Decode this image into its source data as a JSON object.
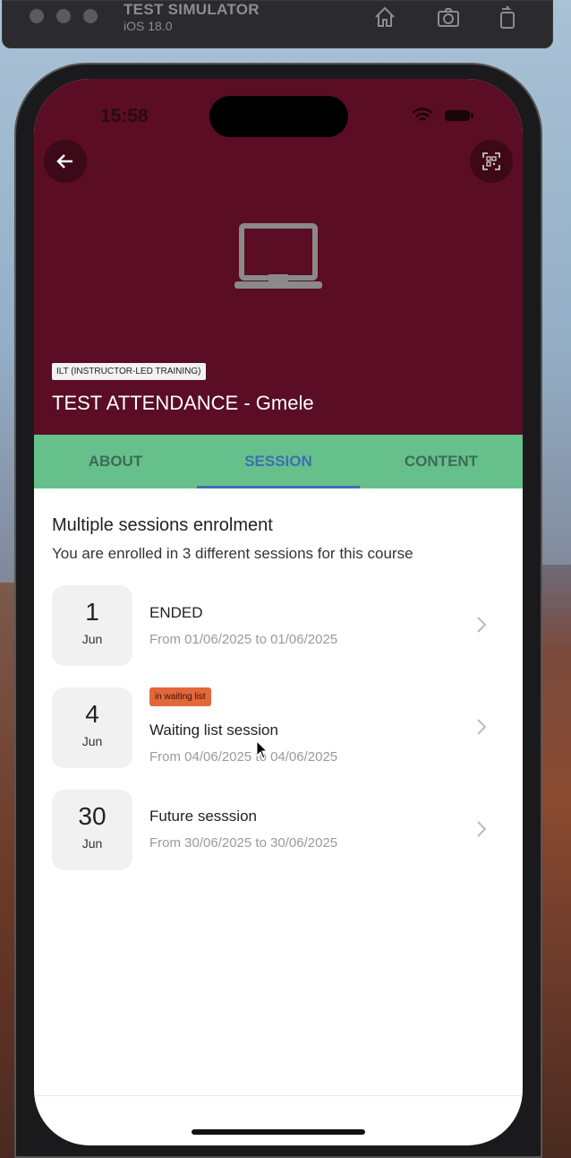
{
  "simulator": {
    "title": "TEST SIMULATOR",
    "subtitle": "iOS 18.0"
  },
  "status_bar": {
    "time": "15:58"
  },
  "hero": {
    "type_badge": "ILT (INSTRUCTOR-LED TRAINING)",
    "course_title": "TEST ATTENDANCE - Gmele"
  },
  "tabs": [
    {
      "label": "ABOUT",
      "active": false
    },
    {
      "label": "SESSION",
      "active": true
    },
    {
      "label": "CONTENT",
      "active": false
    }
  ],
  "enrolment": {
    "title": "Multiple sessions enrolment",
    "subtitle": "You are enrolled in 3 different sessions for this course"
  },
  "sessions": [
    {
      "day": "1",
      "month": "Jun",
      "badge": "",
      "name": "ENDED",
      "range": "From 01/06/2025 to 01/06/2025"
    },
    {
      "day": "4",
      "month": "Jun",
      "badge": "in waiting list",
      "name": "Waiting list session",
      "range": "From 04/06/2025 to 04/06/2025"
    },
    {
      "day": "30",
      "month": "Jun",
      "badge": "",
      "name": "Future sesssion",
      "range": "From 30/06/2025 to 30/06/2025"
    }
  ],
  "colors": {
    "hero_bg": "#5a0d25",
    "tabs_bg": "#66c08c",
    "active_tab": "#3b6fb3",
    "waiting_badge": "#e2673a"
  },
  "icons": [
    "back-arrow-icon",
    "qr-code-icon",
    "laptop-icon",
    "chevron-right-icon",
    "home-icon",
    "screenshot-icon",
    "rotate-icon"
  ]
}
